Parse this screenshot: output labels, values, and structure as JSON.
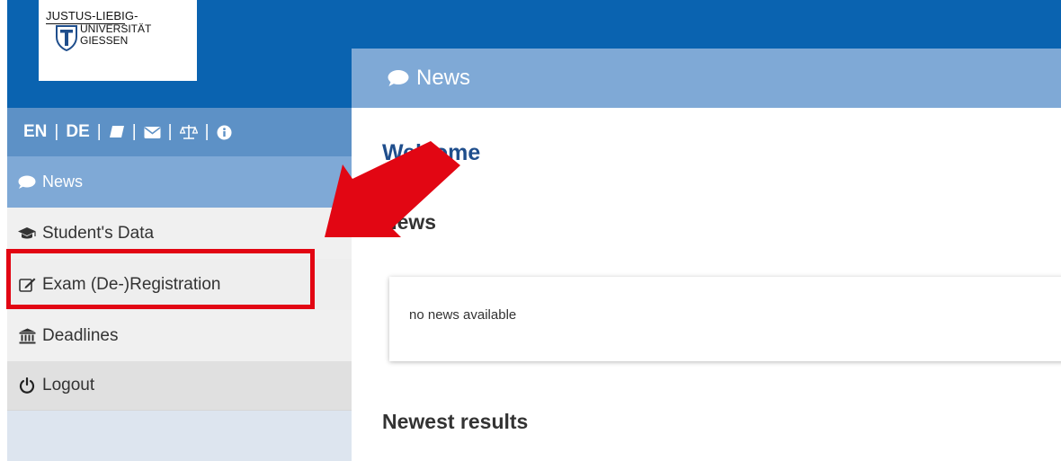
{
  "logo": {
    "line1": "JUSTUS-LIEBIG-",
    "line2": "UNIVERSITÄT",
    "line3": "GIESSEN"
  },
  "language_bar": {
    "en": "EN",
    "de": "DE",
    "separator": "|",
    "icons": [
      "book-icon",
      "envelope-icon",
      "balance-scale-icon",
      "info-icon"
    ]
  },
  "sidebar": {
    "items": [
      {
        "label": "News",
        "icon": "comment-icon"
      },
      {
        "label": "Student's Data",
        "icon": "graduation-cap-icon"
      },
      {
        "label": "Exam (De-)Registration",
        "icon": "edit-icon"
      },
      {
        "label": "Deadlines",
        "icon": "institution-icon"
      },
      {
        "label": "Logout",
        "icon": "power-icon"
      }
    ]
  },
  "main": {
    "header_title": "News",
    "welcome": "Welcome",
    "news_heading": "News",
    "news_empty": "no news available",
    "newest_results_heading": "Newest results"
  },
  "colors": {
    "topbar": "#0a63b0",
    "header": "#7fa9d6",
    "language_bar": "#5d91c6",
    "highlight": "#e20613",
    "arrow": "#e20613"
  }
}
